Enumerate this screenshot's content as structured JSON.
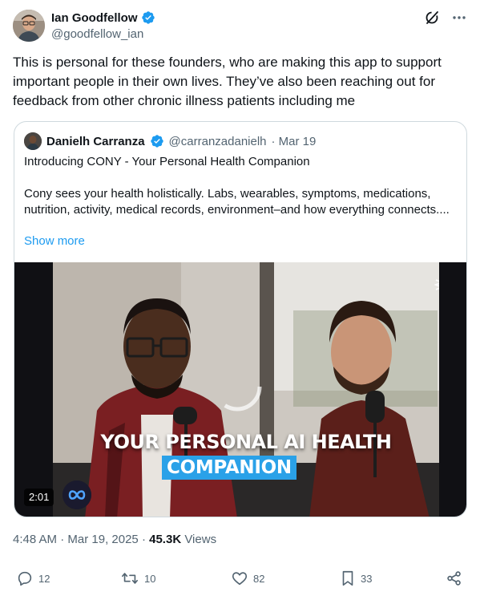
{
  "tweet": {
    "author": {
      "name": "Ian Goodfellow",
      "handle": "@goodfellow_ian"
    },
    "text": "This is personal for these founders, who are making this app to support important people in their own lives. They’ve also been reaching out for feedback from other chronic illness patients including me",
    "timestamp": {
      "time": "4:48 AM",
      "sep1": " · ",
      "date": "Mar 19, 2025",
      "sep2": " · ",
      "views_count": "45.3K",
      "views_label": " Views"
    },
    "actions": {
      "replies": "12",
      "reposts": "10",
      "likes": "82",
      "bookmarks": "33"
    }
  },
  "quote": {
    "author": {
      "name": "Danielh Carranza",
      "handle": "@carranzadanielh",
      "date": "· Mar 19"
    },
    "line1": "Introducing CONY - Your Personal Health Companion",
    "line2": "Cony sees your health holistically. Labs, wearables, symptoms, medications, nutrition, activity, medical records, environment–and how everything connects....",
    "show_more": "Show more",
    "video": {
      "caption_line1": "YOUR PERSONAL AI HEALTH",
      "caption_line2": "COMPANION",
      "duration": "2:01"
    }
  },
  "icons": {
    "verified": "verified-badge-icon",
    "grok": "grok-icon",
    "more": "more-icon",
    "reply": "reply-icon",
    "repost": "repost-icon",
    "like": "like-icon",
    "bookmark": "bookmark-icon",
    "share": "share-icon"
  },
  "colors": {
    "verified": "#1d9bf0",
    "link": "#1d9bf0",
    "secondary_text": "#536471",
    "caption_highlight": "#2aa1e8"
  }
}
